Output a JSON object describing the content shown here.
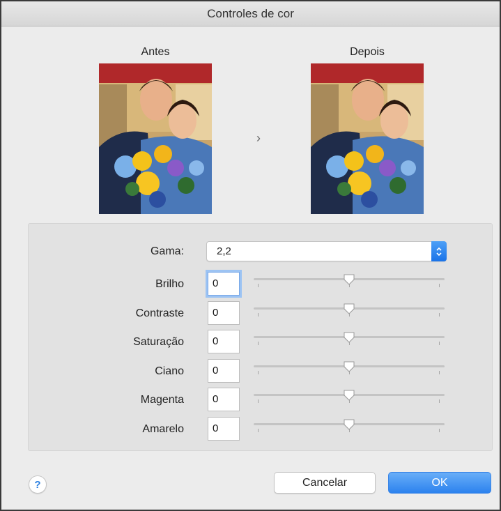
{
  "window": {
    "title": "Controles de cor"
  },
  "preview": {
    "before_label": "Antes",
    "after_label": "Depois",
    "arrow": "›"
  },
  "gamma": {
    "label": "Gama:",
    "value": "2,2"
  },
  "adjustments": [
    {
      "label": "Brilho",
      "value": "0",
      "slider_fraction": 0.5
    },
    {
      "label": "Contraste",
      "value": "0",
      "slider_fraction": 0.5
    },
    {
      "label": "Saturação",
      "value": "0",
      "slider_fraction": 0.5
    },
    {
      "label": "Ciano",
      "value": "0",
      "slider_fraction": 0.5
    },
    {
      "label": "Magenta",
      "value": "0",
      "slider_fraction": 0.5
    },
    {
      "label": "Amarelo",
      "value": "0",
      "slider_fraction": 0.5
    }
  ],
  "buttons": {
    "help": "?",
    "cancel": "Cancelar",
    "ok": "OK"
  },
  "colors": {
    "accent": "#2c82ee",
    "panel": "#e2e2e2"
  }
}
